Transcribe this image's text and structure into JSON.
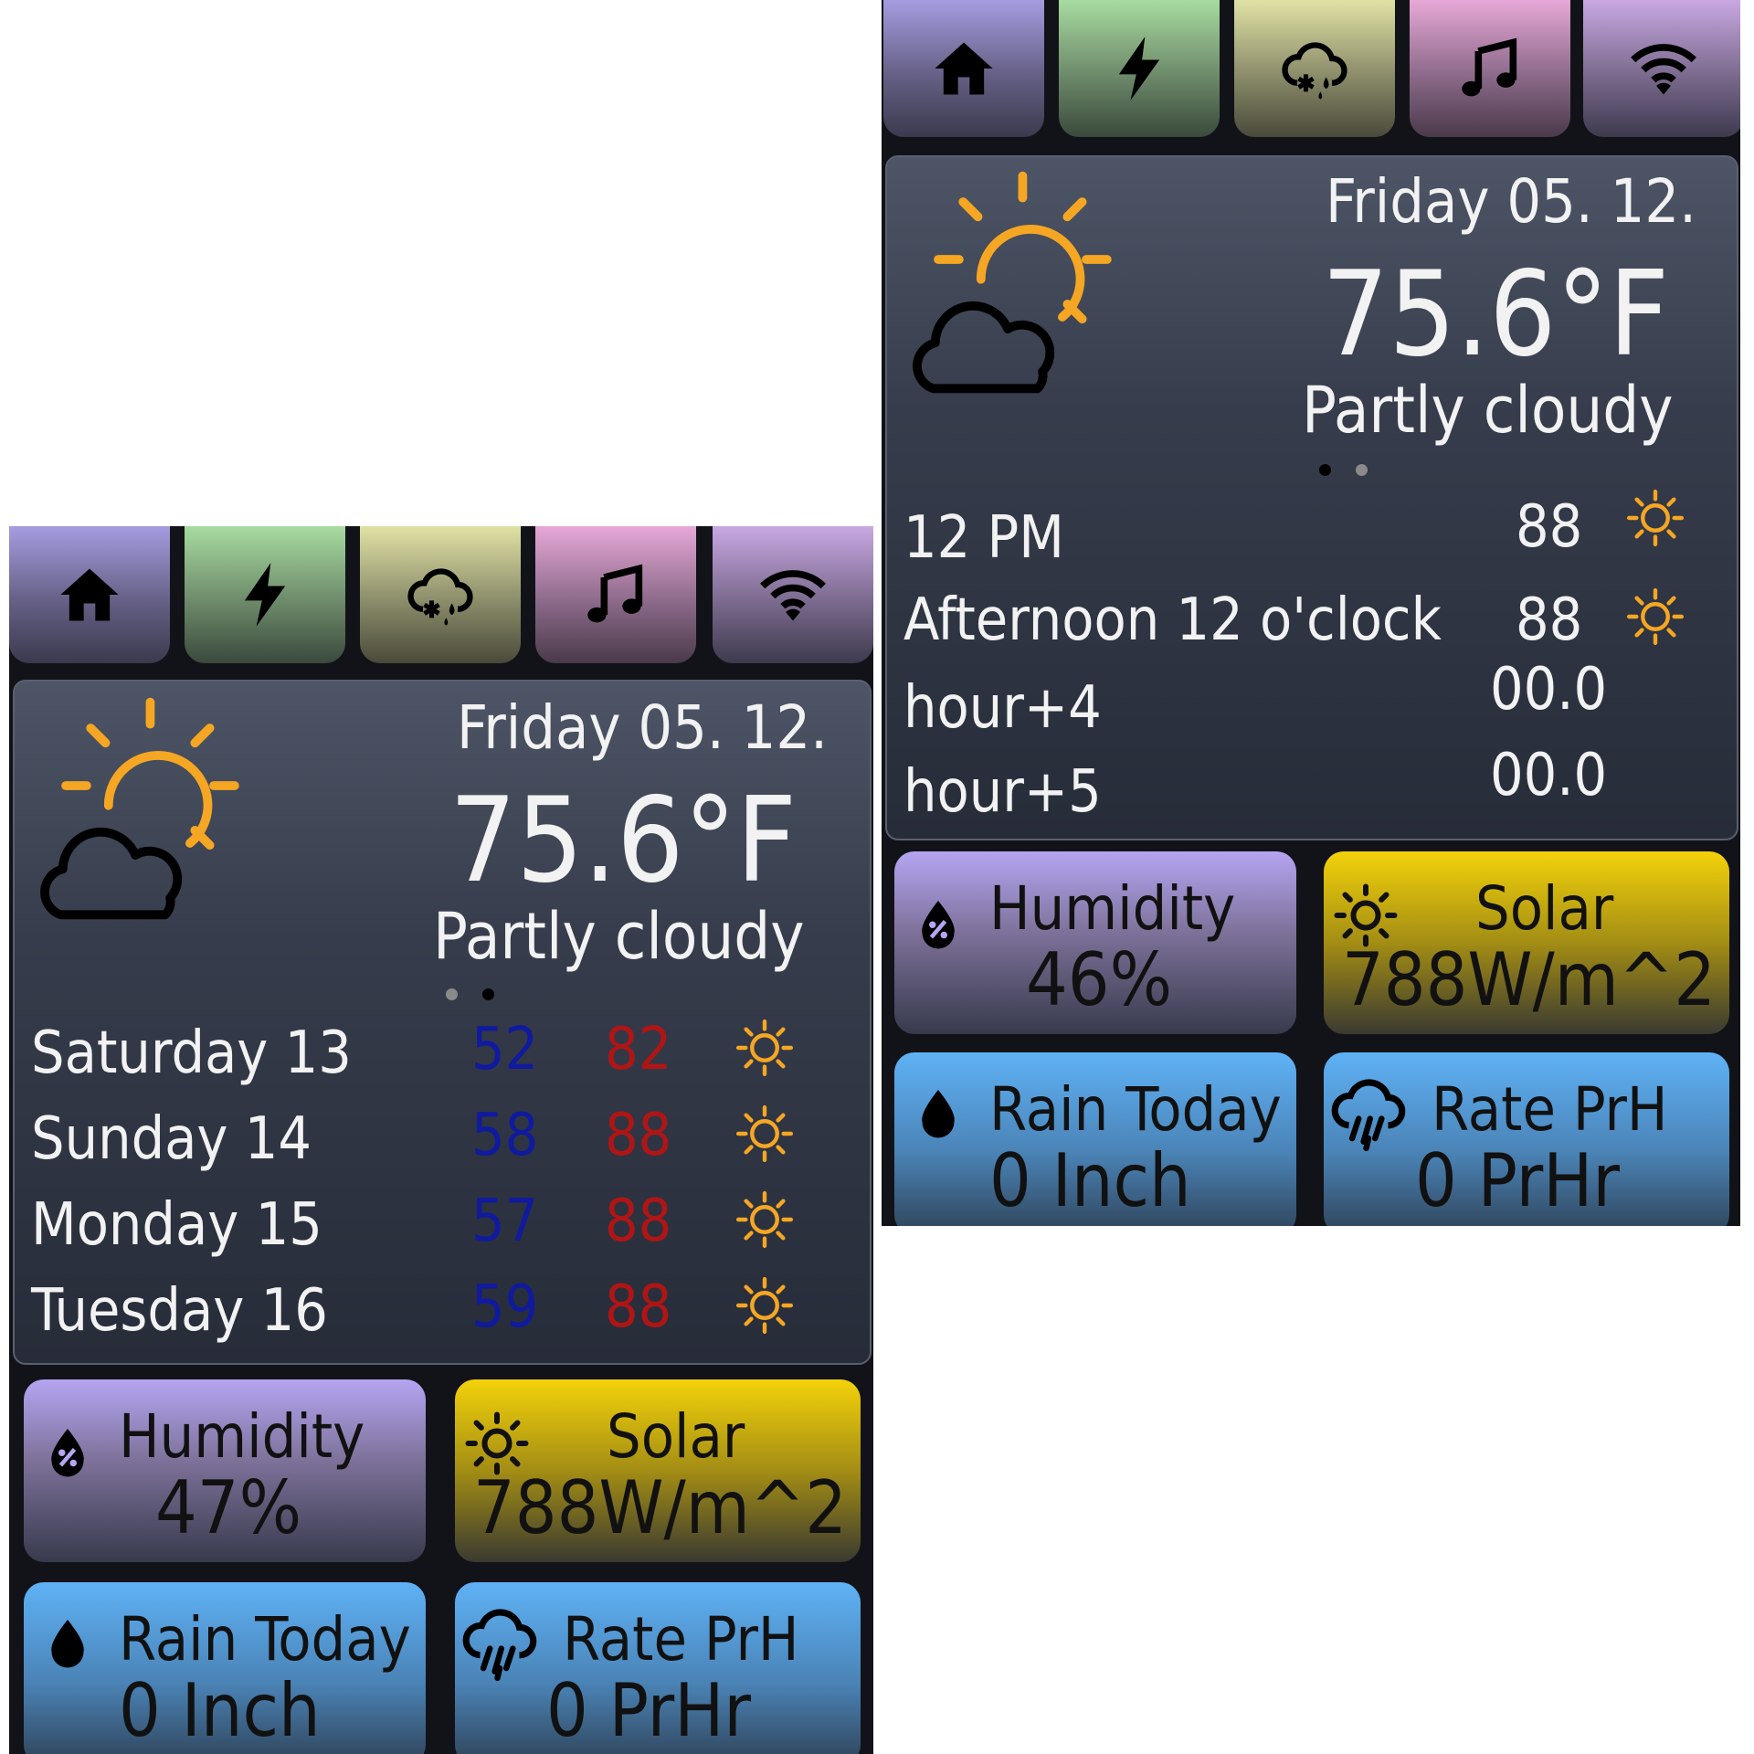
{
  "nav": {
    "tabs": [
      {
        "icon": "home-icon"
      },
      {
        "icon": "lightning-icon"
      },
      {
        "icon": "snow-rain-cloud-icon"
      },
      {
        "icon": "music-note-icon"
      },
      {
        "icon": "wifi-icon"
      }
    ]
  },
  "screens": [
    {
      "current": {
        "date": "Friday 05. 12.",
        "temperature": "75.6°F",
        "condition": "Partly cloudy",
        "icon": "partly-cloudy-icon"
      },
      "page_indicator": {
        "count": 2,
        "active": 2
      },
      "forecast": [
        {
          "day": "Saturday 13",
          "low": "52",
          "high": "82",
          "icon": "sun-icon"
        },
        {
          "day": "Sunday 14",
          "low": "58",
          "high": "88",
          "icon": "sun-icon"
        },
        {
          "day": "Monday 15",
          "low": "57",
          "high": "88",
          "icon": "sun-icon"
        },
        {
          "day": "Tuesday 16",
          "low": "59",
          "high": "88",
          "icon": "sun-icon"
        }
      ],
      "tiles": {
        "humidity": {
          "label": "Humidity",
          "value": "47%"
        },
        "solar": {
          "label": "Solar",
          "value": "788W/m^2"
        },
        "rain": {
          "label": "Rain Today",
          "value": "0 Inch"
        },
        "rate": {
          "label": "Rate PrH",
          "value": "0 PrHr"
        }
      }
    },
    {
      "current": {
        "date": "Friday 05. 12.",
        "temperature": "75.6°F",
        "condition": "Partly cloudy",
        "icon": "partly-cloudy-icon"
      },
      "page_indicator": {
        "count": 2,
        "active": 1
      },
      "hourly": [
        {
          "time": "12 PM",
          "value": "88",
          "icon": "sun-icon"
        },
        {
          "time": "Afternoon 12 o'clock",
          "value": "88",
          "icon": "sun-icon"
        },
        {
          "time": "hour+4",
          "value": "00.0"
        },
        {
          "time": "hour+5",
          "value": "00.0"
        }
      ],
      "tiles": {
        "humidity": {
          "label": "Humidity",
          "value": "46%"
        },
        "solar": {
          "label": "Solar",
          "value": "788W/m^2"
        },
        "rain": {
          "label": "Rain Today",
          "value": "0 Inch"
        },
        "rate": {
          "label": "Rate PrH",
          "value": "0 PrHr"
        }
      }
    }
  ],
  "colors": {
    "accent_sun": "#f5a623",
    "low_temp": "#0f1a9e",
    "high_temp": "#b01515"
  }
}
